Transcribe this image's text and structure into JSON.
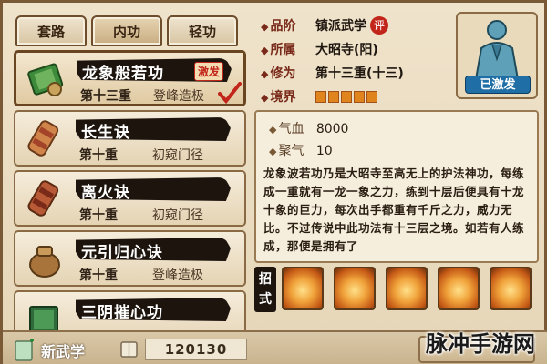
{
  "tabs": [
    "套路",
    "内功",
    "轻功"
  ],
  "skills": [
    {
      "name": "龙象般若功",
      "level": "第十三重",
      "status": "登峰造极",
      "badge": "激发",
      "checked": true
    },
    {
      "name": "长生诀",
      "level": "第十重",
      "status": "初窥门径"
    },
    {
      "name": "离火诀",
      "level": "第十重",
      "status": "初窥门径"
    },
    {
      "name": "元引归心诀",
      "level": "第十重",
      "status": "登峰造极"
    },
    {
      "name": "三阴摧心功",
      "level": "",
      "status": ""
    }
  ],
  "info": {
    "rank_key": "品阶",
    "rank_val": "镇派武学",
    "rank_tag": "评",
    "sect_key": "所属",
    "sect_val": "大昭寺(阳)",
    "cult_key": "修为",
    "cult_val": "第十三重(十三)",
    "realm_key": "境界",
    "realm_bars": 5
  },
  "avatar": {
    "tag": "已激发"
  },
  "stats": {
    "hp_key": "气血",
    "hp_val": "8000",
    "qi_key": "聚气",
    "qi_val": "10"
  },
  "description": "龙象波若功乃是大昭寺至高无上的护法神功，每练成一重就有一龙一象之力，练到十层后便具有十龙十象的巨力，每次出手都重有千斤之力，威力无比。不过传说中此功法有十三层之境。如若有人练成，那便是拥有了",
  "moves_label": "招式",
  "moves": [
    "move-1",
    "move-2",
    "move-3",
    "move-4",
    "move-5"
  ],
  "bottom": {
    "new_label": "新武学",
    "coin_value": "120130"
  },
  "watermark": "脉冲手游网",
  "colors": {
    "accent": "#c2261b",
    "ink": "#1c140d",
    "realm": "#e0841e",
    "tag": "#1f6fa6"
  }
}
